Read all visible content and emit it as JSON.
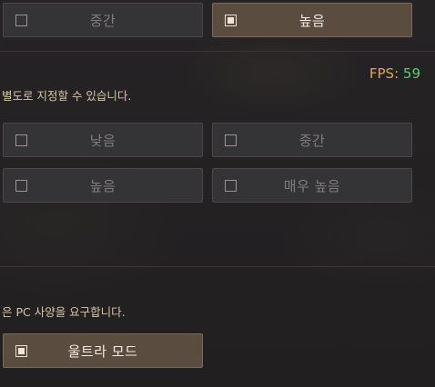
{
  "top_row": {
    "left_label": "중간",
    "right_label": "높음"
  },
  "fps": {
    "label": "FPS:",
    "value": "59"
  },
  "section1": {
    "description": "별도로 지정할 수 있습니다.",
    "options": [
      "낮음",
      "중간",
      "높음",
      "매우 높음"
    ]
  },
  "section2": {
    "description": "은 PC 사양을 요구합니다.",
    "ultra_label": "울트라 모드"
  }
}
